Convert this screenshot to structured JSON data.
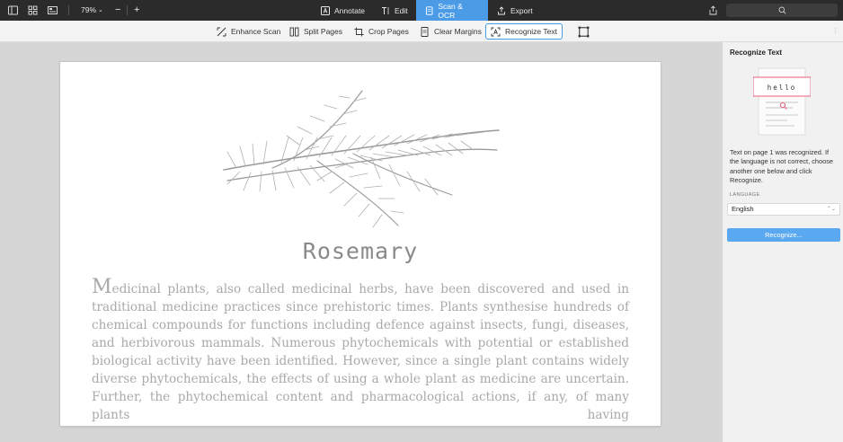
{
  "toolbar": {
    "zoom": "79%",
    "zoom_out": "−",
    "zoom_in": "+",
    "tabs": [
      {
        "label": "Annotate",
        "icon": "annotate-icon"
      },
      {
        "label": "Edit",
        "icon": "edit-text-icon"
      },
      {
        "label": "Scan & OCR",
        "icon": "scan-icon",
        "active": true
      },
      {
        "label": "Export",
        "icon": "export-icon"
      }
    ]
  },
  "subtoolbar": {
    "tools": [
      {
        "label": "Enhance Scan",
        "icon": "enhance-scan-icon"
      },
      {
        "label": "Split Pages",
        "icon": "split-pages-icon"
      },
      {
        "label": "Crop Pages",
        "icon": "crop-icon"
      },
      {
        "label": "Clear Margins",
        "icon": "clear-margins-icon"
      },
      {
        "label": "Recognize Text",
        "icon": "recognize-text-icon",
        "selected": true
      }
    ]
  },
  "document": {
    "title": "Rosemary",
    "dropcap": "M",
    "body": "edicinal plants, also called medicinal herbs, have been discovered and used in traditional medicine practices since prehistoric times. Plants synthesise hundreds of chemical compounds for functions including defence against insects, fungi, diseases, and herbivorous mammals. Numerous phytochemicals with potential or established biological activity have been identified. However, since a single plant contains widely diverse phytochemicals, the effects of using a whole plant as medicine are uncertain. Further, the phytochemical content and pharmacological actions, if any, of many plants having"
  },
  "panel": {
    "title": "Recognize Text",
    "illustration_word": "hello",
    "description": "Text on page 1 was recognized. If the language is not correct, choose another one below and click Recognize.",
    "language_label": "LANGUAGE",
    "language_value": "English",
    "button": "Recognize..."
  },
  "colors": {
    "accent": "#4b9be6",
    "topbar": "#2b2b2b",
    "button": "#5aa8f0",
    "highlight": "#e8627a"
  }
}
